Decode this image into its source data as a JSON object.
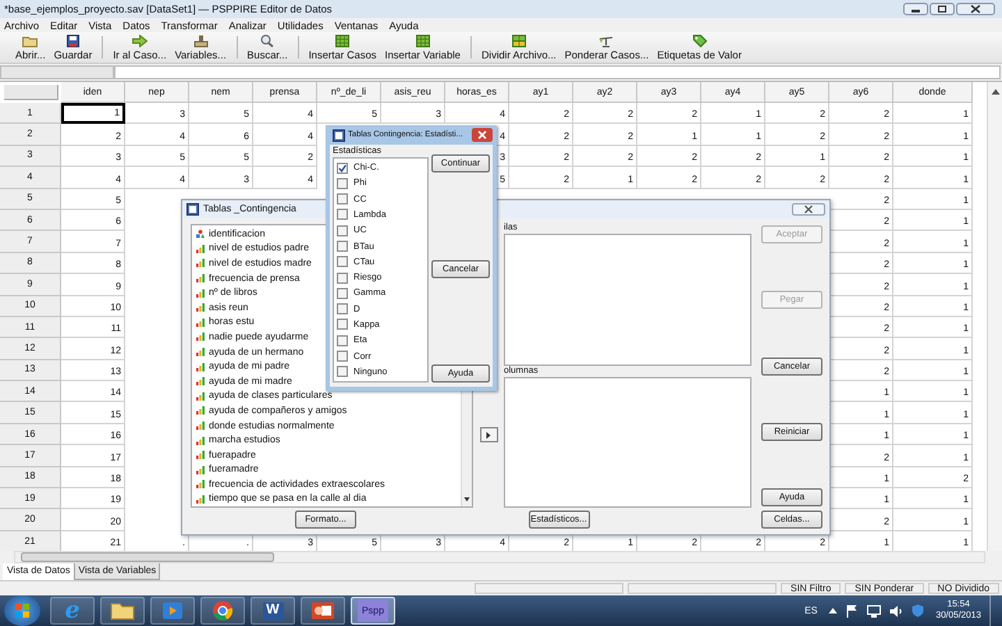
{
  "window": {
    "title": "*base_ejemplos_proyecto.sav [DataSet1] — PSPPIRE Editor de Datos"
  },
  "menu": [
    "Archivo",
    "Editar",
    "Vista",
    "Datos",
    "Transformar",
    "Analizar",
    "Utilidades",
    "Ventanas",
    "Ayuda"
  ],
  "toolbar": [
    [
      {
        "label": "Abrir...",
        "kind": "open"
      },
      {
        "label": "Guardar",
        "kind": "save"
      }
    ],
    [
      {
        "label": "Ir al Caso...",
        "kind": "goto"
      },
      {
        "label": "Variables...",
        "kind": "variables"
      }
    ],
    [
      {
        "label": "Buscar...",
        "kind": "find"
      }
    ],
    [
      {
        "label": "Insertar Casos",
        "kind": "insert"
      },
      {
        "label": "Insertar Variable",
        "kind": "insert"
      }
    ],
    [
      {
        "label": "Dividir Archivo...",
        "kind": "split"
      },
      {
        "label": "Ponderar Casos...",
        "kind": "weight"
      },
      {
        "label": "Etiquetas de Valor",
        "kind": "labels"
      }
    ]
  ],
  "table": {
    "columns": [
      "iden",
      "nep",
      "nem",
      "prensa",
      "nº_de_li",
      "asis_reu",
      "horas_es",
      "ay1",
      "ay2",
      "ay3",
      "ay4",
      "ay5",
      "ay6",
      "donde"
    ],
    "rows": [
      {
        "label": "1",
        "current": true,
        "cells": [
          "1",
          "3",
          "5",
          "4",
          "5",
          "3",
          "4",
          "2",
          "2",
          "2",
          "1",
          "2",
          "2",
          "1"
        ]
      },
      {
        "label": "2",
        "current": false,
        "cells": [
          "2",
          "4",
          "6",
          "4",
          null,
          null,
          "4",
          "2",
          "2",
          "1",
          "1",
          "2",
          "2",
          "1"
        ]
      },
      {
        "label": "3",
        "current": false,
        "cells": [
          "3",
          "5",
          "5",
          "2",
          null,
          null,
          "3",
          "2",
          "2",
          "2",
          "2",
          "1",
          "2",
          "1"
        ]
      },
      {
        "label": "4",
        "current": false,
        "cells": [
          "4",
          "4",
          "3",
          "4",
          null,
          null,
          "5",
          "2",
          "1",
          "2",
          "2",
          "2",
          "2",
          "1"
        ]
      },
      {
        "label": "5",
        "current": false,
        "cells": [
          "5",
          null,
          null,
          null,
          null,
          null,
          null,
          null,
          null,
          null,
          null,
          null,
          "2",
          "1"
        ]
      },
      {
        "label": "6",
        "current": false,
        "cells": [
          "6",
          null,
          null,
          null,
          null,
          null,
          null,
          null,
          null,
          null,
          null,
          null,
          "2",
          "1"
        ]
      },
      {
        "label": "7",
        "current": false,
        "cells": [
          "7",
          null,
          null,
          null,
          null,
          null,
          null,
          null,
          null,
          null,
          null,
          null,
          "2",
          "1"
        ]
      },
      {
        "label": "8",
        "current": false,
        "cells": [
          "8",
          null,
          null,
          null,
          null,
          null,
          null,
          null,
          null,
          null,
          null,
          null,
          "2",
          "1"
        ]
      },
      {
        "label": "9",
        "current": false,
        "cells": [
          "9",
          null,
          null,
          null,
          null,
          null,
          null,
          null,
          null,
          null,
          null,
          null,
          "2",
          "1"
        ]
      },
      {
        "label": "10",
        "current": false,
        "cells": [
          "10",
          null,
          null,
          null,
          null,
          null,
          null,
          null,
          null,
          null,
          null,
          null,
          "2",
          "1"
        ]
      },
      {
        "label": "11",
        "current": false,
        "cells": [
          "11",
          null,
          null,
          null,
          null,
          null,
          null,
          null,
          null,
          null,
          null,
          null,
          "2",
          "1"
        ]
      },
      {
        "label": "12",
        "current": false,
        "cells": [
          "12",
          null,
          null,
          null,
          null,
          null,
          null,
          null,
          null,
          null,
          null,
          null,
          "2",
          "1"
        ]
      },
      {
        "label": "13",
        "current": false,
        "cells": [
          "13",
          null,
          null,
          null,
          null,
          null,
          null,
          null,
          null,
          null,
          null,
          null,
          "2",
          "1"
        ]
      },
      {
        "label": "14",
        "current": false,
        "cells": [
          "14",
          null,
          null,
          null,
          null,
          null,
          null,
          null,
          null,
          null,
          null,
          null,
          "1",
          "1"
        ]
      },
      {
        "label": "15",
        "current": false,
        "cells": [
          "15",
          null,
          null,
          null,
          null,
          null,
          null,
          null,
          null,
          null,
          null,
          null,
          "1",
          "1"
        ]
      },
      {
        "label": "16",
        "current": false,
        "cells": [
          "16",
          null,
          null,
          null,
          null,
          null,
          null,
          null,
          null,
          null,
          null,
          null,
          "1",
          "1"
        ]
      },
      {
        "label": "17",
        "current": false,
        "cells": [
          "17",
          null,
          null,
          null,
          null,
          null,
          null,
          null,
          null,
          null,
          null,
          null,
          "2",
          "1"
        ]
      },
      {
        "label": "18",
        "current": false,
        "cells": [
          "18",
          null,
          null,
          null,
          null,
          null,
          null,
          null,
          null,
          null,
          null,
          null,
          "1",
          "2"
        ]
      },
      {
        "label": "19",
        "current": false,
        "cells": [
          "19",
          null,
          null,
          null,
          null,
          null,
          null,
          null,
          null,
          null,
          null,
          null,
          "1",
          "1"
        ]
      },
      {
        "label": "20",
        "current": false,
        "cells": [
          "20",
          null,
          null,
          null,
          null,
          null,
          null,
          null,
          null,
          null,
          null,
          null,
          "2",
          "1"
        ]
      },
      {
        "label": "21",
        "current": false,
        "cells": [
          "21",
          ".",
          ".",
          "3",
          "5",
          "3",
          "4",
          "2",
          "1",
          "2",
          "2",
          "2",
          "1",
          "1"
        ]
      }
    ]
  },
  "view_tabs": [
    {
      "label": "Vista de Datos",
      "selected": true
    },
    {
      "label": "Vista de Variables",
      "selected": false
    }
  ],
  "status_bar": [
    "SIN Filtro",
    "SIN Ponderar",
    "NO Dividido"
  ],
  "crosstabs_dialog": {
    "title": "Tablas _Contingencia",
    "variables": [
      {
        "name": "identificacion",
        "kind": "nominal"
      },
      {
        "name": "nivel de estudios padre",
        "kind": "ordinal"
      },
      {
        "name": "nivel de estudios madre",
        "kind": "ordinal"
      },
      {
        "name": "frecuencia de prensa",
        "kind": "ordinal"
      },
      {
        "name": "nº de libros",
        "kind": "ordinal"
      },
      {
        "name": "asis reun",
        "kind": "ordinal"
      },
      {
        "name": "horas estu",
        "kind": "ordinal"
      },
      {
        "name": "nadie puede ayudarme",
        "kind": "ordinal"
      },
      {
        "name": "ayuda de un hermano",
        "kind": "ordinal"
      },
      {
        "name": "ayuda de mi padre",
        "kind": "ordinal"
      },
      {
        "name": "ayuda de mi madre",
        "kind": "ordinal"
      },
      {
        "name": "ayuda de clases particulares",
        "kind": "ordinal"
      },
      {
        "name": "ayuda de compañeros y amigos",
        "kind": "ordinal"
      },
      {
        "name": "donde estudias normalmente",
        "kind": "ordinal"
      },
      {
        "name": "marcha estudios",
        "kind": "ordinal"
      },
      {
        "name": "fuerapadre",
        "kind": "ordinal"
      },
      {
        "name": "fueramadre",
        "kind": "ordinal"
      },
      {
        "name": "frecuencia de actividades extraescolares",
        "kind": "ordinal"
      },
      {
        "name": "tiempo que se pasa en la calle al dia",
        "kind": "ordinal"
      }
    ],
    "rows_label": "ilas",
    "columns_label": "olumnas",
    "side_buttons": [
      {
        "label": "Aceptar",
        "disabled": true
      },
      {
        "label": "Pegar",
        "disabled": true
      },
      {
        "label": "Cancelar",
        "disabled": false
      },
      {
        "label": "Reiniciar",
        "disabled": false
      },
      {
        "label": "Ayuda",
        "disabled": false
      }
    ],
    "bottom_buttons": [
      "Formato...",
      "Estadísticos...",
      "Celdas..."
    ]
  },
  "statistics_dialog": {
    "title": "Tablas Contingencia: Estadísti...",
    "group_label": "Estadísticas",
    "options": [
      {
        "label": "Chi-C.",
        "checked": true
      },
      {
        "label": "Phi",
        "checked": false
      },
      {
        "label": "CC",
        "checked": false
      },
      {
        "label": "Lambda",
        "checked": false
      },
      {
        "label": "UC",
        "checked": false
      },
      {
        "label": "BTau",
        "checked": false
      },
      {
        "label": "CTau",
        "checked": false
      },
      {
        "label": "Riesgo",
        "checked": false
      },
      {
        "label": "Gamma",
        "checked": false
      },
      {
        "label": "D",
        "checked": false
      },
      {
        "label": "Kappa",
        "checked": false
      },
      {
        "label": "Eta",
        "checked": false
      },
      {
        "label": "Corr",
        "checked": false
      },
      {
        "label": "Ninguno",
        "checked": false
      }
    ],
    "buttons": [
      "Continuar",
      "Cancelar",
      "Ayuda"
    ]
  },
  "taskbar": {
    "apps": [
      {
        "kind": "browser",
        "glyph": "e",
        "selected": false
      },
      {
        "kind": "folder",
        "selected": false
      },
      {
        "kind": "media",
        "selected": false
      },
      {
        "kind": "chrome",
        "selected": false
      },
      {
        "kind": "word",
        "glyph": "W",
        "selected": false
      },
      {
        "kind": "slides",
        "selected": false
      },
      {
        "kind": "pspp",
        "glyph": "Pspp",
        "selected": true
      }
    ],
    "language": "ES",
    "time": "15:54",
    "date": "30/05/2013"
  }
}
